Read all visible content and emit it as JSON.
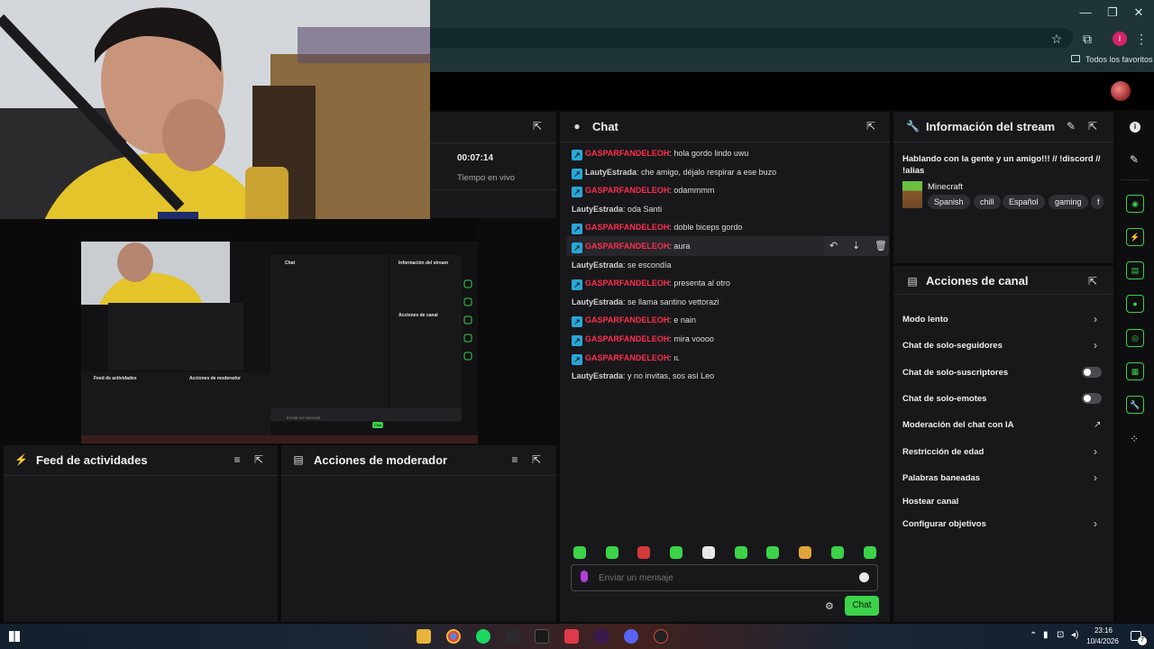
{
  "browser": {
    "bookmarks_label": "Todos los favoritos",
    "profile_initial": "I"
  },
  "stream_stats": {
    "uptime": "00:07:14",
    "uptime_label": "Tiempo en vivo"
  },
  "chat": {
    "title": "Chat",
    "messages": [
      {
        "user": "GASPARFANDELEOH",
        "text": ": hola gordo lindo uwu",
        "badge": true
      },
      {
        "user": "LautyEstrada",
        "text": ": che amigo, déjalo respirar a ese buzo",
        "badge": true
      },
      {
        "user": "GASPARFANDELEOH",
        "text": ": odammmm",
        "badge": true
      },
      {
        "user": "LautyEstrada",
        "text": ": oda Santi",
        "badge": false
      },
      {
        "user": "GASPARFANDELEOH",
        "text": ": doble biceps gordo",
        "badge": true
      },
      {
        "user": "GASPARFANDELEOH",
        "text": ": aura",
        "badge": true
      },
      {
        "user": "LautyEstrada",
        "text": ": se escondía",
        "badge": false
      },
      {
        "user": "GASPARFANDELEOH",
        "text": ": presenta al otro",
        "badge": true
      },
      {
        "user": "LautyEstrada",
        "text": ": se llama santino vettorazi",
        "badge": false
      },
      {
        "user": "GASPARFANDELEOH",
        "text": ": e nain",
        "badge": true
      },
      {
        "user": "GASPARFANDELEOH",
        "text": ": mira voooo",
        "badge": true
      },
      {
        "user": "GASPARFANDELEOH",
        "text": ": ıʟ",
        "badge": true
      },
      {
        "user": "LautyEstrada",
        "text": ": y no invitas, sos así Leo",
        "badge": false
      }
    ],
    "input_placeholder": "Enviar un mensaje",
    "send_label": "Chat"
  },
  "stream_info": {
    "title": "Información del stream",
    "stream_title": "Hablando con la gente y un amigo!!! // !discord // !alias",
    "category": "Minecraft",
    "tags": [
      "Spanish",
      "chill",
      "Español",
      "gaming",
      "f"
    ]
  },
  "channel_actions": {
    "title": "Acciones de canal",
    "items": [
      {
        "label": "Modo lento",
        "control": "chevron"
      },
      {
        "label": "Chat de solo-seguidores",
        "control": "chevron"
      },
      {
        "label": "Chat de solo-suscriptores",
        "control": "toggle"
      },
      {
        "label": "Chat de solo-emotes",
        "control": "toggle"
      },
      {
        "label": "Moderación del chat con IA",
        "control": "external"
      },
      {
        "label": "Restricción de edad",
        "control": "chevron"
      },
      {
        "label": "Palabras baneadas",
        "control": "chevron"
      },
      {
        "label": "Hostear canal",
        "control": "none"
      },
      {
        "label": "Configurar objetivos",
        "control": "chevron"
      }
    ]
  },
  "activity_feed": {
    "title": "Feed de actividades"
  },
  "mod_actions": {
    "title": "Acciones de moderador"
  },
  "nested_preview": {
    "chat_title": "Chat",
    "info_title": "Información del stream",
    "actions_title": "Acciones de canal",
    "feed_title": "Feed de actividades",
    "mod_title": "Acciones de moderador",
    "input_placeholder": "Enviar un mensaje",
    "send_label": "Chat"
  },
  "taskbar": {
    "time": "23:16",
    "date": "10/4/2026",
    "notification_count": "7"
  },
  "colors": {
    "accent_green": "#3cd24a",
    "username_red": "#ff2e4d",
    "badge_blue": "#2aa7d8",
    "panel_bg": "#18181b"
  }
}
